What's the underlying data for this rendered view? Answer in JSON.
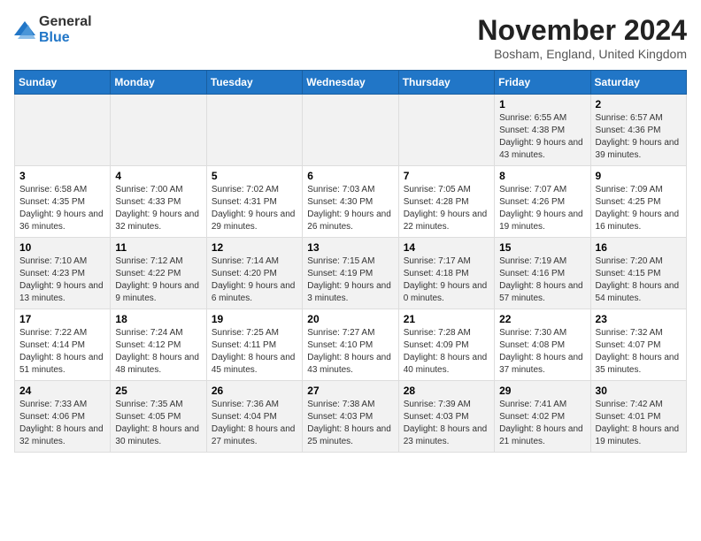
{
  "header": {
    "logo_general": "General",
    "logo_blue": "Blue",
    "title": "November 2024",
    "subtitle": "Bosham, England, United Kingdom"
  },
  "columns": [
    "Sunday",
    "Monday",
    "Tuesday",
    "Wednesday",
    "Thursday",
    "Friday",
    "Saturday"
  ],
  "weeks": [
    [
      {
        "day": "",
        "sunrise": "",
        "sunset": "",
        "daylight": ""
      },
      {
        "day": "",
        "sunrise": "",
        "sunset": "",
        "daylight": ""
      },
      {
        "day": "",
        "sunrise": "",
        "sunset": "",
        "daylight": ""
      },
      {
        "day": "",
        "sunrise": "",
        "sunset": "",
        "daylight": ""
      },
      {
        "day": "",
        "sunrise": "",
        "sunset": "",
        "daylight": ""
      },
      {
        "day": "1",
        "sunrise": "Sunrise: 6:55 AM",
        "sunset": "Sunset: 4:38 PM",
        "daylight": "Daylight: 9 hours and 43 minutes."
      },
      {
        "day": "2",
        "sunrise": "Sunrise: 6:57 AM",
        "sunset": "Sunset: 4:36 PM",
        "daylight": "Daylight: 9 hours and 39 minutes."
      }
    ],
    [
      {
        "day": "3",
        "sunrise": "Sunrise: 6:58 AM",
        "sunset": "Sunset: 4:35 PM",
        "daylight": "Daylight: 9 hours and 36 minutes."
      },
      {
        "day": "4",
        "sunrise": "Sunrise: 7:00 AM",
        "sunset": "Sunset: 4:33 PM",
        "daylight": "Daylight: 9 hours and 32 minutes."
      },
      {
        "day": "5",
        "sunrise": "Sunrise: 7:02 AM",
        "sunset": "Sunset: 4:31 PM",
        "daylight": "Daylight: 9 hours and 29 minutes."
      },
      {
        "day": "6",
        "sunrise": "Sunrise: 7:03 AM",
        "sunset": "Sunset: 4:30 PM",
        "daylight": "Daylight: 9 hours and 26 minutes."
      },
      {
        "day": "7",
        "sunrise": "Sunrise: 7:05 AM",
        "sunset": "Sunset: 4:28 PM",
        "daylight": "Daylight: 9 hours and 22 minutes."
      },
      {
        "day": "8",
        "sunrise": "Sunrise: 7:07 AM",
        "sunset": "Sunset: 4:26 PM",
        "daylight": "Daylight: 9 hours and 19 minutes."
      },
      {
        "day": "9",
        "sunrise": "Sunrise: 7:09 AM",
        "sunset": "Sunset: 4:25 PM",
        "daylight": "Daylight: 9 hours and 16 minutes."
      }
    ],
    [
      {
        "day": "10",
        "sunrise": "Sunrise: 7:10 AM",
        "sunset": "Sunset: 4:23 PM",
        "daylight": "Daylight: 9 hours and 13 minutes."
      },
      {
        "day": "11",
        "sunrise": "Sunrise: 7:12 AM",
        "sunset": "Sunset: 4:22 PM",
        "daylight": "Daylight: 9 hours and 9 minutes."
      },
      {
        "day": "12",
        "sunrise": "Sunrise: 7:14 AM",
        "sunset": "Sunset: 4:20 PM",
        "daylight": "Daylight: 9 hours and 6 minutes."
      },
      {
        "day": "13",
        "sunrise": "Sunrise: 7:15 AM",
        "sunset": "Sunset: 4:19 PM",
        "daylight": "Daylight: 9 hours and 3 minutes."
      },
      {
        "day": "14",
        "sunrise": "Sunrise: 7:17 AM",
        "sunset": "Sunset: 4:18 PM",
        "daylight": "Daylight: 9 hours and 0 minutes."
      },
      {
        "day": "15",
        "sunrise": "Sunrise: 7:19 AM",
        "sunset": "Sunset: 4:16 PM",
        "daylight": "Daylight: 8 hours and 57 minutes."
      },
      {
        "day": "16",
        "sunrise": "Sunrise: 7:20 AM",
        "sunset": "Sunset: 4:15 PM",
        "daylight": "Daylight: 8 hours and 54 minutes."
      }
    ],
    [
      {
        "day": "17",
        "sunrise": "Sunrise: 7:22 AM",
        "sunset": "Sunset: 4:14 PM",
        "daylight": "Daylight: 8 hours and 51 minutes."
      },
      {
        "day": "18",
        "sunrise": "Sunrise: 7:24 AM",
        "sunset": "Sunset: 4:12 PM",
        "daylight": "Daylight: 8 hours and 48 minutes."
      },
      {
        "day": "19",
        "sunrise": "Sunrise: 7:25 AM",
        "sunset": "Sunset: 4:11 PM",
        "daylight": "Daylight: 8 hours and 45 minutes."
      },
      {
        "day": "20",
        "sunrise": "Sunrise: 7:27 AM",
        "sunset": "Sunset: 4:10 PM",
        "daylight": "Daylight: 8 hours and 43 minutes."
      },
      {
        "day": "21",
        "sunrise": "Sunrise: 7:28 AM",
        "sunset": "Sunset: 4:09 PM",
        "daylight": "Daylight: 8 hours and 40 minutes."
      },
      {
        "day": "22",
        "sunrise": "Sunrise: 7:30 AM",
        "sunset": "Sunset: 4:08 PM",
        "daylight": "Daylight: 8 hours and 37 minutes."
      },
      {
        "day": "23",
        "sunrise": "Sunrise: 7:32 AM",
        "sunset": "Sunset: 4:07 PM",
        "daylight": "Daylight: 8 hours and 35 minutes."
      }
    ],
    [
      {
        "day": "24",
        "sunrise": "Sunrise: 7:33 AM",
        "sunset": "Sunset: 4:06 PM",
        "daylight": "Daylight: 8 hours and 32 minutes."
      },
      {
        "day": "25",
        "sunrise": "Sunrise: 7:35 AM",
        "sunset": "Sunset: 4:05 PM",
        "daylight": "Daylight: 8 hours and 30 minutes."
      },
      {
        "day": "26",
        "sunrise": "Sunrise: 7:36 AM",
        "sunset": "Sunset: 4:04 PM",
        "daylight": "Daylight: 8 hours and 27 minutes."
      },
      {
        "day": "27",
        "sunrise": "Sunrise: 7:38 AM",
        "sunset": "Sunset: 4:03 PM",
        "daylight": "Daylight: 8 hours and 25 minutes."
      },
      {
        "day": "28",
        "sunrise": "Sunrise: 7:39 AM",
        "sunset": "Sunset: 4:03 PM",
        "daylight": "Daylight: 8 hours and 23 minutes."
      },
      {
        "day": "29",
        "sunrise": "Sunrise: 7:41 AM",
        "sunset": "Sunset: 4:02 PM",
        "daylight": "Daylight: 8 hours and 21 minutes."
      },
      {
        "day": "30",
        "sunrise": "Sunrise: 7:42 AM",
        "sunset": "Sunset: 4:01 PM",
        "daylight": "Daylight: 8 hours and 19 minutes."
      }
    ]
  ]
}
